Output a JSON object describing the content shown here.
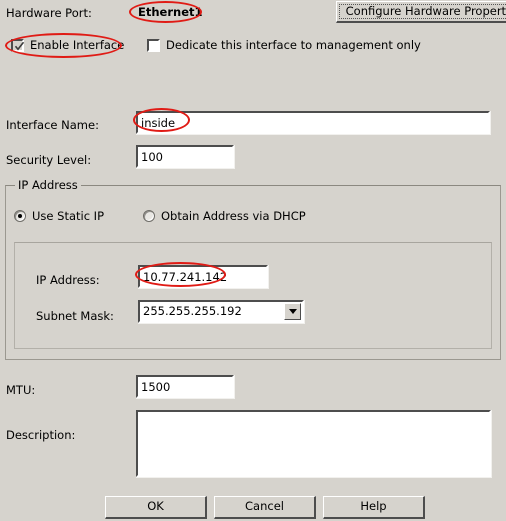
{
  "dialog": {
    "background_color": "#d6d3cd",
    "annotation_color": "#e01b15"
  },
  "hardware_port": {
    "label": "Hardware Port:",
    "value": "Ethernet1",
    "annotated": true
  },
  "configure_hardware_button": {
    "label": "Configure Hardware Properties",
    "truncated_label": "Configure Hardware Propertie"
  },
  "enable_interface": {
    "label": "Enable Interface",
    "checked": true,
    "annotated": true
  },
  "dedicate_management": {
    "label": "Dedicate this interface to management only",
    "checked": false
  },
  "interface_name": {
    "label": "Interface Name:",
    "value": "inside",
    "annotated": true
  },
  "security_level": {
    "label": "Security Level:",
    "value": "100"
  },
  "ip_address_group": {
    "title": "IP Address",
    "use_static_ip": {
      "label": "Use Static IP",
      "selected": true
    },
    "obtain_dhcp": {
      "label": "Obtain Address via DHCP",
      "selected": false
    },
    "ip_address": {
      "label": "IP Address:",
      "value": "10.77.241.142",
      "annotated": true
    },
    "subnet_mask": {
      "label": "Subnet Mask:",
      "value": "255.255.255.192"
    }
  },
  "mtu": {
    "label": "MTU:",
    "value": "1500"
  },
  "description": {
    "label": "Description:",
    "value": ""
  },
  "buttons": {
    "ok": "OK",
    "cancel": "Cancel",
    "help": "Help"
  }
}
